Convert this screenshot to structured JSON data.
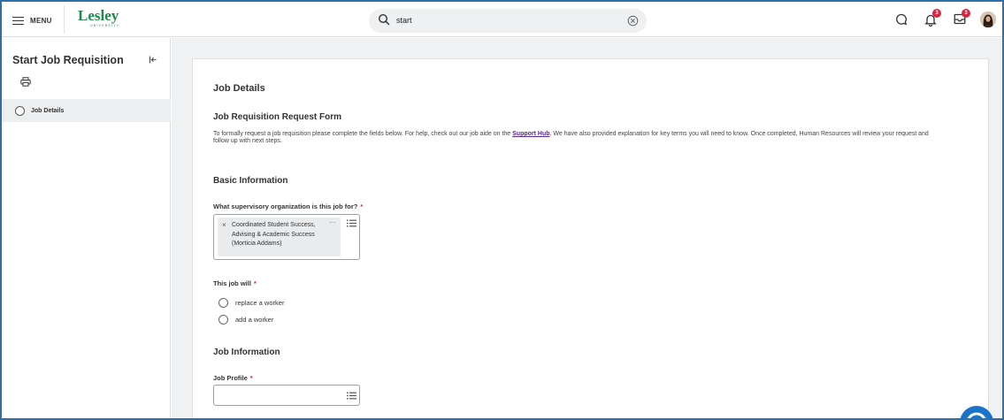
{
  "topbar": {
    "menu_label": "MENU",
    "logo_text": "Lesley",
    "logo_subtext": "UNIVERSITY",
    "search_value": "start",
    "notifications_count": "3",
    "inbox_count": "3"
  },
  "sidebar": {
    "title": "Start Job Requisition",
    "steps": [
      {
        "label": "Job Details"
      }
    ]
  },
  "form": {
    "page_heading": "Job Details",
    "form_title": "Job Requisition Request Form",
    "intro_before_link": "To formally request a job requisition please complete the fields below. For help, check out our job aide on the ",
    "intro_link": "Support Hub",
    "intro_after_link": ". We have also provided explanation for key terms you will need to know. Once completed, Human Resources will review your request and follow up with next steps.",
    "basic_info_heading": "Basic Information",
    "supervisory_org": {
      "label": "What supervisory organization is this job for?",
      "required_mark": "*",
      "selected_value": "Coordinated Student Success, Advising & Academic Success (Morticia Addams)",
      "more_glyph": "···",
      "remove_glyph": "×"
    },
    "job_will": {
      "label": "This job will",
      "required_mark": "*",
      "options": [
        "replace a worker",
        "add a worker"
      ]
    },
    "job_info_heading": "Job Information",
    "job_profile": {
      "label": "Job Profile",
      "required_mark": "*",
      "value": ""
    }
  },
  "colors": {
    "brand_green": "#1e8a4a",
    "required_red": "#d7263d",
    "link_purple": "#5b2a91",
    "frame_blue": "#2d6fa8",
    "chat_blue": "#1a73c8"
  },
  "icons": [
    "hamburger-icon",
    "search-icon",
    "clear-icon",
    "chat-bubble-icon",
    "bell-icon",
    "inbox-icon",
    "collapse-panel-icon",
    "print-icon",
    "list-icon",
    "chat-help-icon"
  ]
}
